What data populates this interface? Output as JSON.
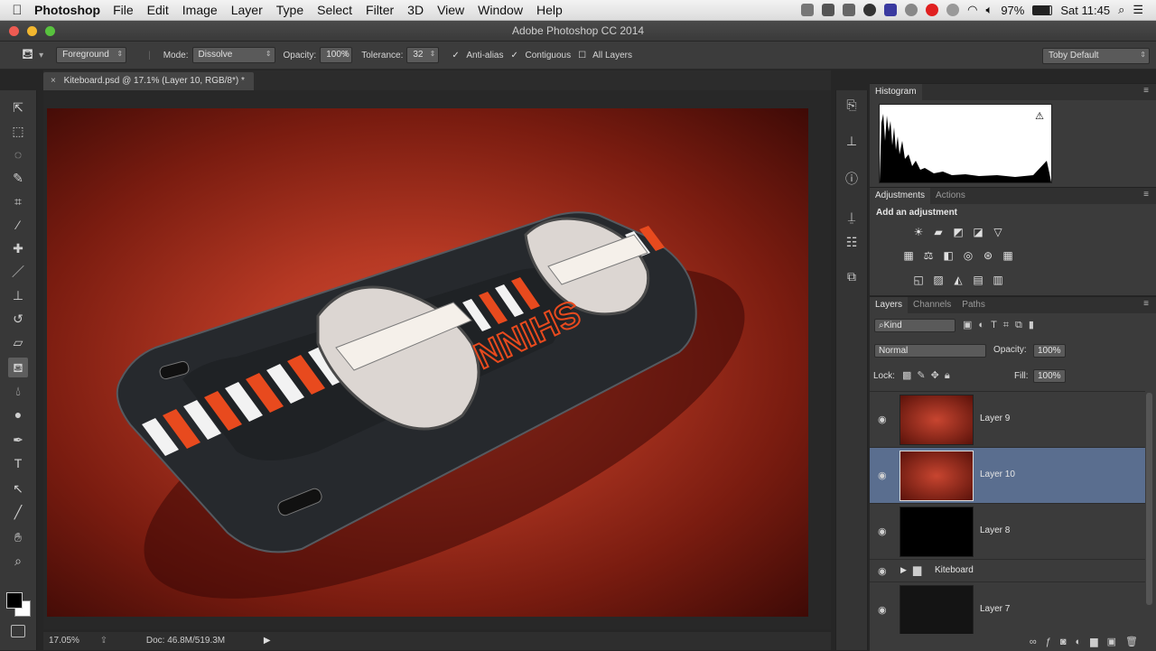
{
  "menubar": {
    "app_name": "Photoshop",
    "items": [
      "File",
      "Edit",
      "Image",
      "Layer",
      "Type",
      "Select",
      "Filter",
      "3D",
      "View",
      "Window",
      "Help"
    ],
    "battery": "97%",
    "clock": "Sat 11:45"
  },
  "window": {
    "title": "Adobe Photoshop CC 2014"
  },
  "options": {
    "fill_source": "Foreground",
    "mode_label": "Mode:",
    "mode_value": "Dissolve",
    "opacity_label": "Opacity:",
    "opacity_value": "100%",
    "tolerance_label": "Tolerance:",
    "tolerance_value": "32",
    "antialias": "Anti-alias",
    "contiguous": "Contiguous",
    "all_layers": "All Layers",
    "workspace": "Toby Default"
  },
  "document": {
    "tab_title": "Kiteboard.psd @ 17.1% (Layer 10, RGB/8*) *",
    "board_text": "SHINN"
  },
  "status": {
    "zoom": "17.05%",
    "doc_size": "Doc: 46.8M/519.3M"
  },
  "histogram": {
    "tab": "Histogram"
  },
  "adjustments": {
    "tab": "Adjustments",
    "tab2": "Actions",
    "heading": "Add an adjustment"
  },
  "layers_panel": {
    "tabs": [
      "Layers",
      "Channels",
      "Paths"
    ],
    "filter_kind": "Kind",
    "blend_mode": "Normal",
    "opacity_label": "Opacity:",
    "opacity_value": "100%",
    "lock_label": "Lock:",
    "fill_label": "Fill:",
    "fill_value": "100%",
    "layers": [
      {
        "name": "Layer 9"
      },
      {
        "name": "Layer 10"
      },
      {
        "name": "Layer 8"
      },
      {
        "name": "Kiteboard"
      },
      {
        "name": "Layer 7"
      }
    ]
  },
  "colors": {
    "selected_layer": "#5a6e8f",
    "canvas_bg": "#b63924"
  }
}
